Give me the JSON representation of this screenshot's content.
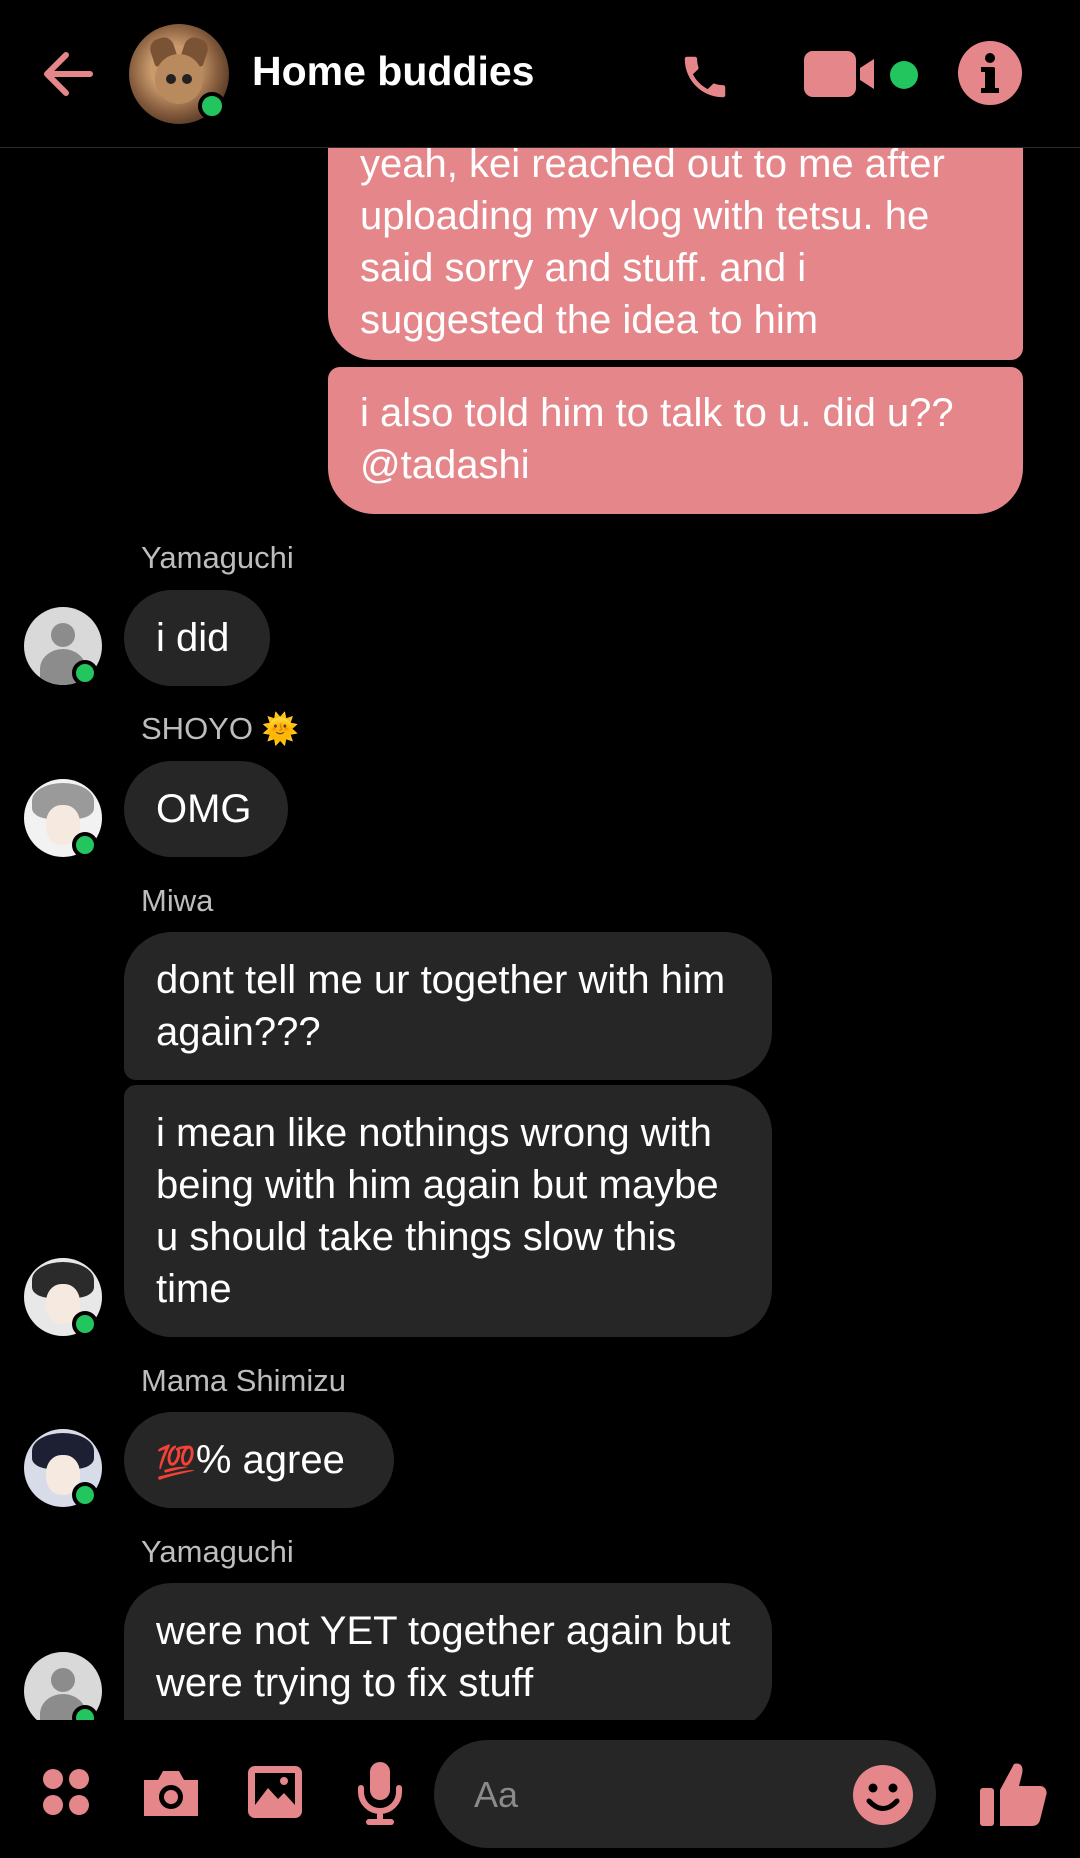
{
  "header": {
    "title": "Home buddies",
    "icons": [
      "back-arrow-icon",
      "phone-icon",
      "video-icon",
      "info-icon"
    ]
  },
  "messages": [
    {
      "sender": "",
      "side": "me",
      "text": "yeah, kei reached out to me after uploading my vlog with tetsu. he said sorry and stuff. and i suggested the idea to him"
    },
    {
      "sender": "",
      "side": "me",
      "text": "i also told him to talk to u. did u?? @tadashi"
    },
    {
      "sender": "Yamaguchi",
      "side": "them",
      "text": "i did"
    },
    {
      "sender": "SHOYO",
      "sender_emoji": "🌞",
      "side": "them",
      "text": "OMG"
    },
    {
      "sender": "Miwa",
      "side": "them",
      "text": "dont tell me ur together with him again???"
    },
    {
      "sender": "",
      "side": "them",
      "text": "i mean like nothings wrong with being with him again but maybe u should take things slow this time"
    },
    {
      "sender": "Mama Shimizu",
      "side": "them",
      "emoji": "💯",
      "text": "% agree"
    },
    {
      "sender": "Yamaguchi",
      "side": "them",
      "text": "were not YET together again but were trying to fix stuff"
    }
  ],
  "composer": {
    "placeholder": "Aa"
  },
  "colors": {
    "accent": "#e5868a",
    "online": "#22c55e",
    "bubble_them": "#262626",
    "background": "#000000"
  }
}
